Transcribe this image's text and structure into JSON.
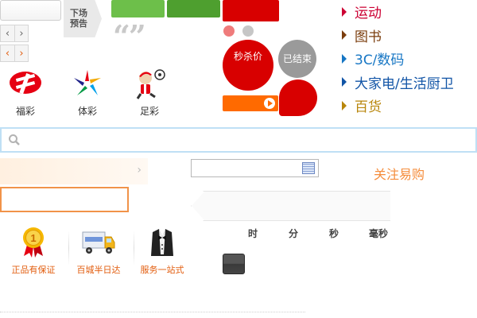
{
  "top": {
    "next_show_line1": "下场",
    "next_show_line2": "预告",
    "prev_arrow": "‹",
    "next_arrow": "›",
    "quote_glyph": "“”"
  },
  "lottery": [
    {
      "label": "福彩",
      "icon": "welfare-lottery-icon"
    },
    {
      "label": "体彩",
      "icon": "sports-lottery-icon"
    },
    {
      "label": "足彩",
      "icon": "football-lottery-icon"
    }
  ],
  "flash_sale": {
    "seckill_label": "秒杀价",
    "ended_label": "已结束"
  },
  "categories": [
    {
      "label": "运动",
      "color": "#cc0033"
    },
    {
      "label": "图书",
      "color": "#7a3c0c"
    },
    {
      "label": "3C/数码",
      "color": "#1676c4"
    },
    {
      "label": "大家电/生活厨卫",
      "color": "#1154a6"
    },
    {
      "label": "百货",
      "color": "#b8860b"
    }
  ],
  "search": {
    "placeholder": ""
  },
  "follow_label": "关注易购",
  "countdown": {
    "hour": "时",
    "minute": "分",
    "second": "秒",
    "millisecond": "毫秒"
  },
  "features": [
    {
      "label": "正品有保证",
      "icon": "genuine-guarantee-icon"
    },
    {
      "label": "百城半日达",
      "icon": "delivery-truck-icon"
    },
    {
      "label": "服务一站式",
      "icon": "butler-service-icon"
    }
  ],
  "colors": {
    "brand_red": "#d80000",
    "accent_orange": "#f58d3c",
    "green": "#6dbf4a"
  }
}
